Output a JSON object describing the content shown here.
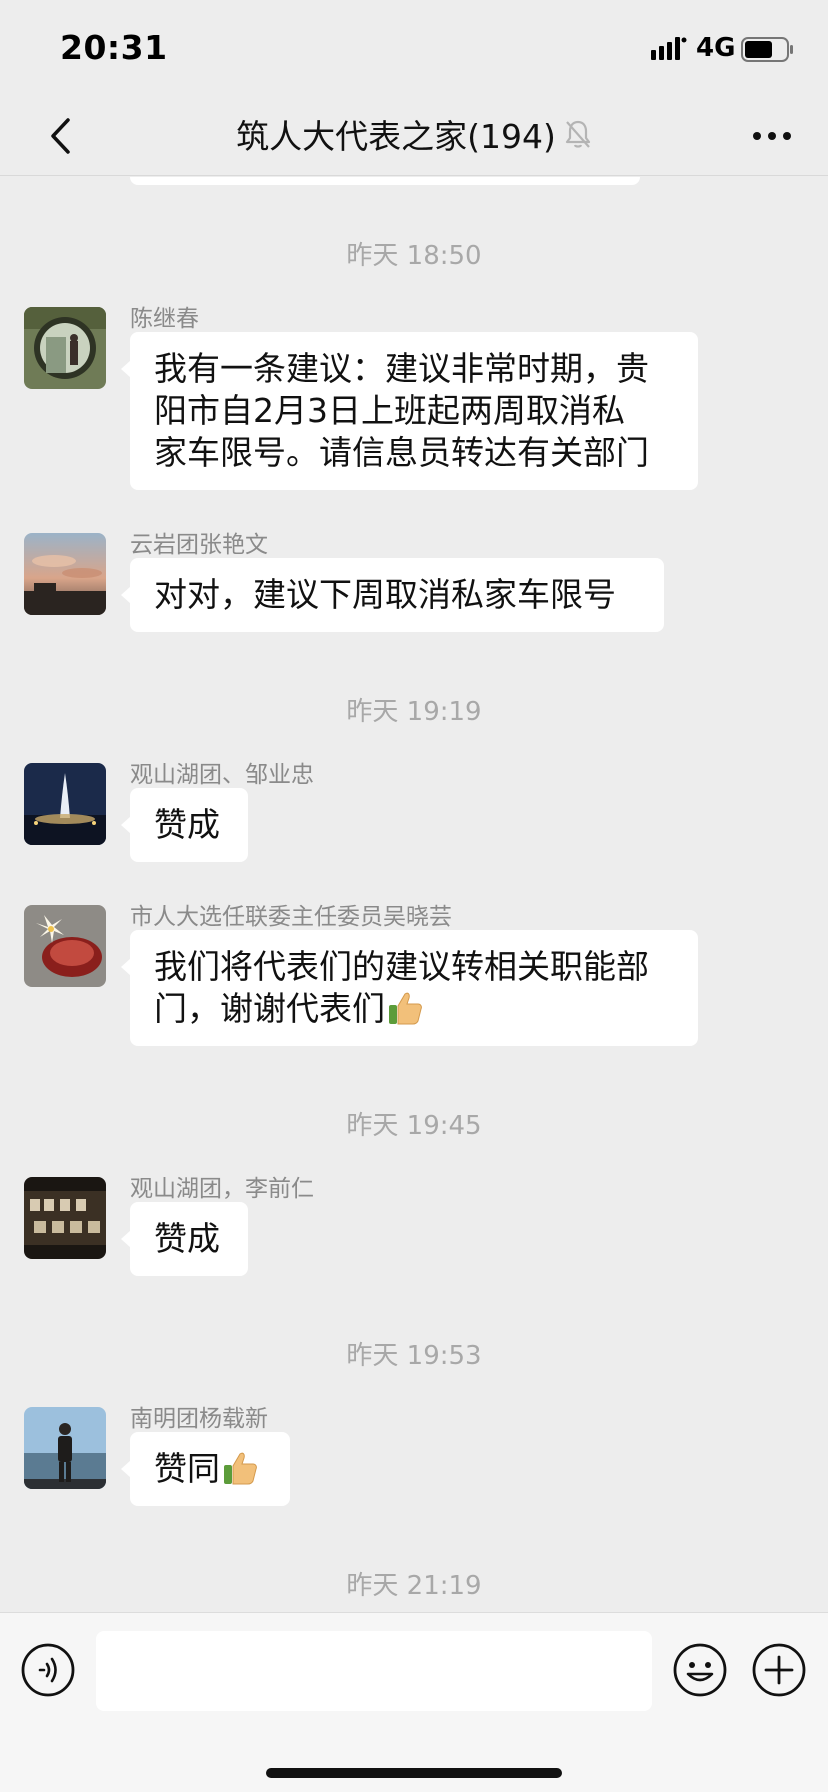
{
  "status_bar": {
    "time": "20:31",
    "network": "4G"
  },
  "nav": {
    "title": "筑人大代表之家(194)"
  },
  "timestamps": [
    "昨天 18:50",
    "昨天 19:19",
    "昨天 19:45",
    "昨天 19:53",
    "昨天 21:19"
  ],
  "messages": [
    {
      "sender": "陈继春",
      "lines": [
        "我有一条建议：建议非常时期，贵",
        "阳市自2月3日上班起两周取消私",
        "家车限号。请信息员转达有关部门"
      ]
    },
    {
      "sender": "云岩团张艳文",
      "lines": [
        "对对，建议下周取消私家车限号"
      ]
    },
    {
      "sender": "观山湖团、邹业忠",
      "lines": [
        "赞成"
      ]
    },
    {
      "sender": "市人大选任联委主任委员吴晓芸",
      "lines": [
        "我们将代表们的建议转相关职能部",
        "门，谢谢代表们"
      ]
    },
    {
      "sender": "观山湖团，李前仁",
      "lines": [
        "赞成"
      ]
    },
    {
      "sender": "南明团杨载新",
      "lines": [
        "赞同"
      ]
    }
  ],
  "icons": {
    "back": "chevron-left-icon",
    "mute": "bell-muted-icon",
    "more": "more-dots-icon",
    "voice": "voice-icon",
    "emoji": "emoji-icon",
    "plus": "plus-icon",
    "thumbs_up": "thumbs-up-icon"
  },
  "input": {
    "value": ""
  }
}
